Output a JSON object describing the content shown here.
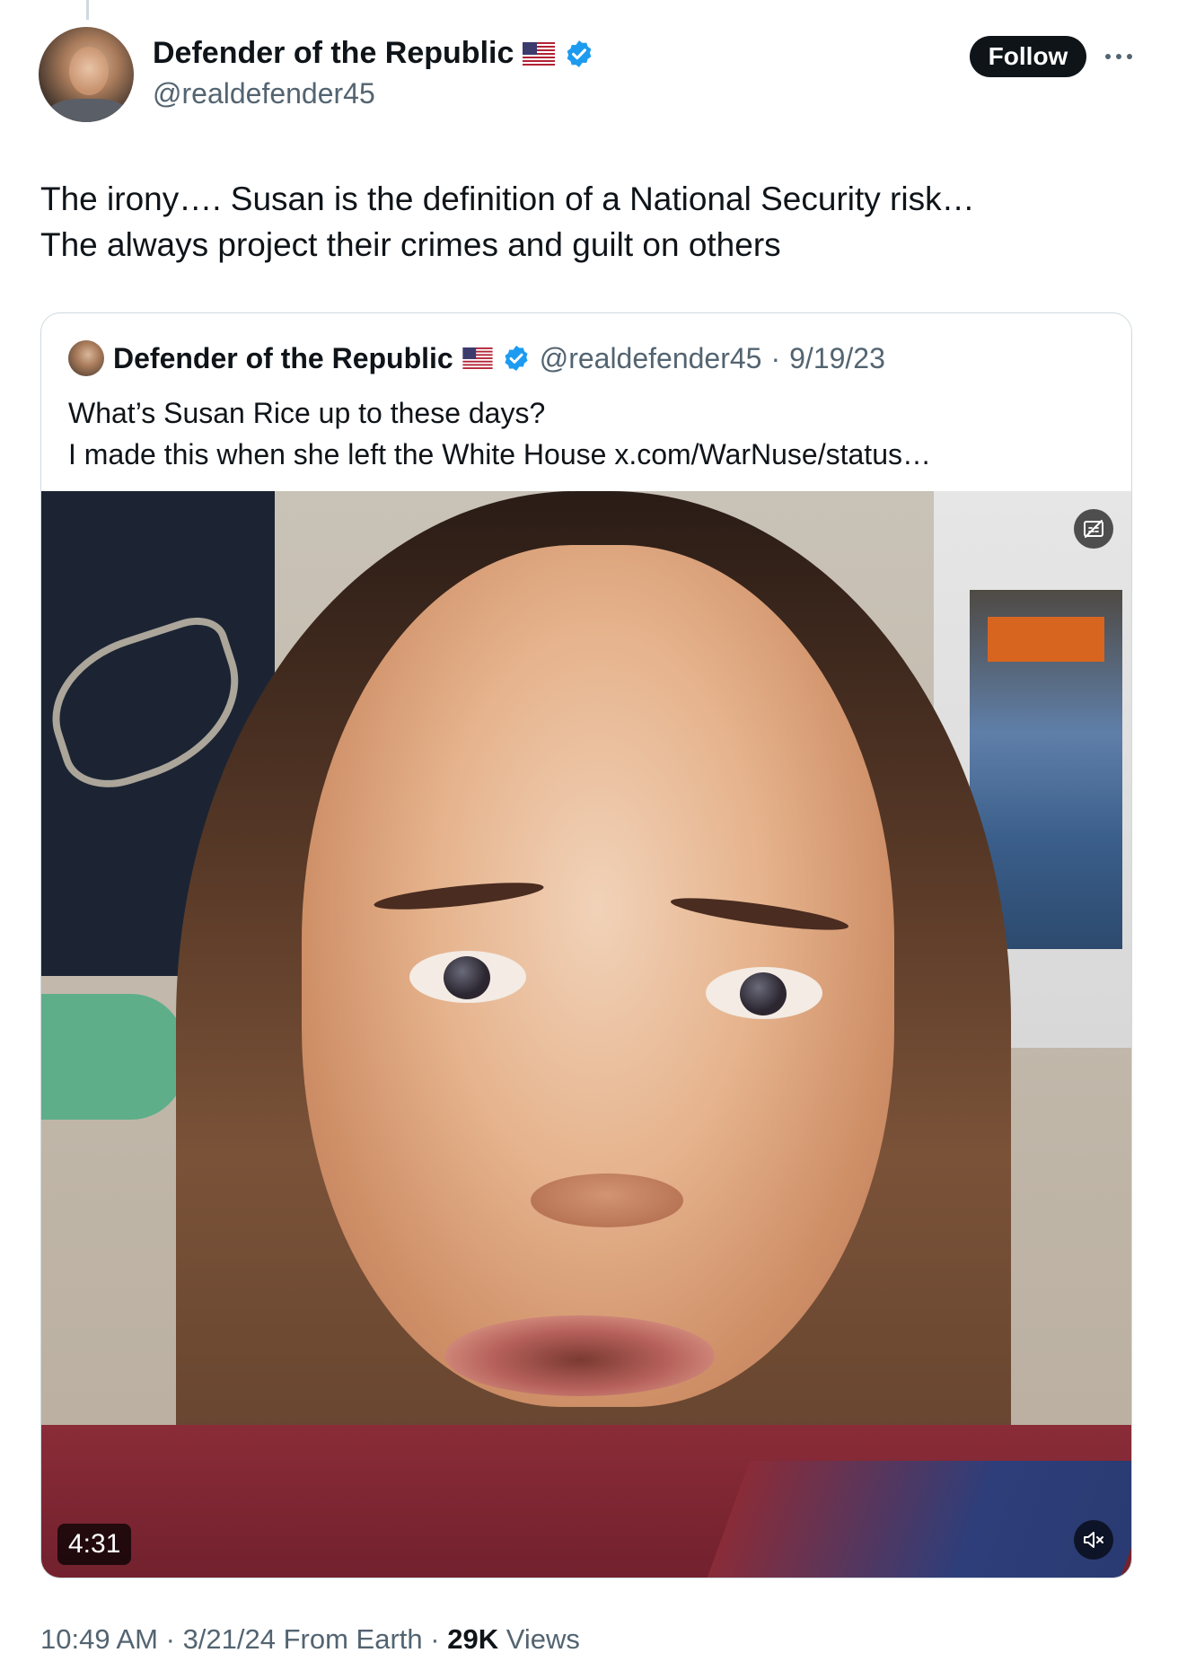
{
  "tweet": {
    "author": {
      "display_name": "Defender of the Republic",
      "handle": "@realdefender45",
      "avatar_icon": "profile-photo",
      "flag_icon": "us-flag-emoji",
      "verified_icon": "verified-badge"
    },
    "follow_label": "Follow",
    "more_icon": "ellipsis-icon",
    "text_lines": [
      "The irony…. Susan is the definition of a National Security risk…",
      "The always project their crimes and guilt on others"
    ],
    "footer": {
      "time": "10:49 AM",
      "separator": "·",
      "date": "3/21/24",
      "source": "From Earth",
      "views_count": "29K",
      "views_label": "Views"
    }
  },
  "quoted": {
    "display_name": "Defender of the Republic",
    "handle": "@realdefender45",
    "separator": "·",
    "date": "9/19/23",
    "text_lines": [
      "What’s Susan Rice up to these days?",
      "I made this when she left the White House x.com/WarNuse/status…"
    ],
    "video": {
      "duration": "4:31",
      "captions_icon": "captions-off-icon",
      "mute_icon": "muted-speaker-icon"
    }
  },
  "colors": {
    "text_primary": "#0f1419",
    "text_secondary": "#536471",
    "verified_blue": "#1d9bf0",
    "border": "#cfd9de",
    "follow_bg": "#0f1419"
  }
}
